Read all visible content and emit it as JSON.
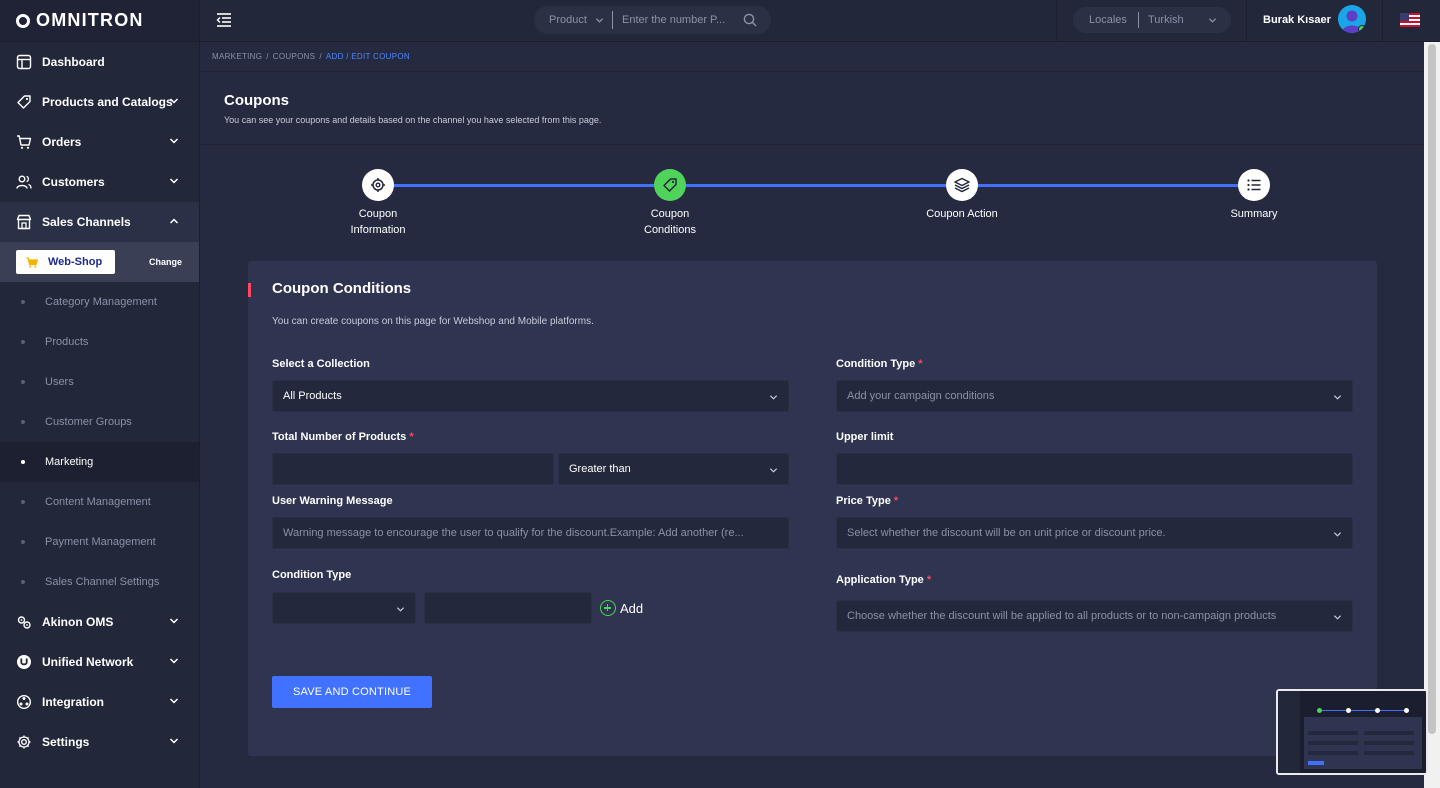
{
  "app": {
    "logo_text": "OMNITRON"
  },
  "sidebar": {
    "items": [
      {
        "label": "Dashboard",
        "icon": "dashboard-icon"
      },
      {
        "label": "Products and Catalogs",
        "icon": "tag-icon"
      },
      {
        "label": "Orders",
        "icon": "cart-icon"
      },
      {
        "label": "Customers",
        "icon": "users-icon"
      },
      {
        "label": "Sales Channels",
        "icon": "store-icon"
      }
    ],
    "channel": {
      "name": "Web-Shop",
      "change_label": "Change"
    },
    "sub_items": [
      "Category Management",
      "Products",
      "Users",
      "Customer Groups",
      "Marketing",
      "Content Management",
      "Payment Management",
      "Sales Channel Settings"
    ],
    "active_sub": "Marketing",
    "bottom_items": [
      {
        "label": "Akinon OMS",
        "icon": "gear-layers-icon"
      },
      {
        "label": "Unified Network",
        "icon": "unified-network-icon"
      },
      {
        "label": "Integration",
        "icon": "integration-icon"
      },
      {
        "label": "Settings",
        "icon": "settings-icon"
      }
    ]
  },
  "topbar": {
    "search_select": "Product",
    "search_placeholder": "Enter the number P...",
    "locale_label": "Locales",
    "locale_value": "Turkish",
    "user_name": "Burak Kısaer"
  },
  "breadcrumb": {
    "items": [
      "MARKETING",
      "COUPONS"
    ],
    "current": "ADD / EDIT COUPON"
  },
  "page": {
    "title": "Coupons",
    "subtitle": "You can see your coupons and details based on the channel you have selected from this page."
  },
  "stepper": {
    "steps": [
      {
        "label_line1": "Coupon",
        "label_line2": "Information",
        "icon": "target-icon"
      },
      {
        "label_line1": "Coupon",
        "label_line2": "Conditions",
        "icon": "tag-icon"
      },
      {
        "label_line1": "Coupon Action",
        "label_line2": "",
        "icon": "layers-icon"
      },
      {
        "label_line1": "Summary",
        "label_line2": "",
        "icon": "list-icon"
      }
    ],
    "active_index": 1
  },
  "form": {
    "title": "Coupon Conditions",
    "description": "You can create coupons on this page for Webshop and Mobile platforms.",
    "collection_label": "Select a Collection",
    "collection_value": "All Products",
    "total_products_label": "Total Number of Products",
    "total_products_value": "",
    "comparator_value": "Greater than",
    "warning_label": "User Warning Message",
    "warning_placeholder": "Warning message to encourage the user to qualify for the discount.Example: Add another (re...",
    "condition_type_label_left": "Condition Type",
    "condition_type_value_left": "",
    "condition_amount_value": "",
    "add_label": "Add",
    "condition_type_label_right": "Condition Type",
    "condition_type_placeholder": "Add your campaign conditions",
    "upper_limit_label": "Upper limit",
    "upper_limit_value": "",
    "price_type_label": "Price Type",
    "price_type_placeholder": "Select whether the discount will be on unit price or discount price.",
    "application_type_label": "Application Type",
    "application_type_placeholder": "Choose whether the discount will be applied to all products or to non-campaign products",
    "save_label": "SAVE AND CONTINUE"
  },
  "colors": {
    "accent": "#4072ff",
    "success": "#4fd35a",
    "required": "#ff4860",
    "sidebar_bg": "#22273a",
    "card_bg": "#2f3450"
  }
}
